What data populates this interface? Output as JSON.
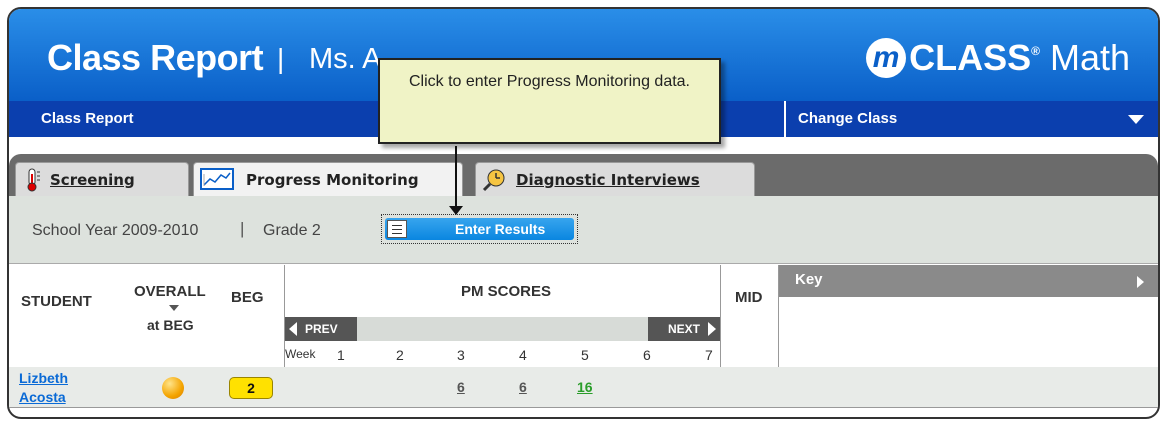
{
  "header": {
    "title": "Class Report",
    "separator": "|",
    "teacher": "Ms. A",
    "logo_m": "m",
    "logo_class": "CLASS",
    "logo_reg": "®",
    "logo_math": "Math"
  },
  "subbar": {
    "left_label": "Class Report",
    "change_class_label": "Change Class"
  },
  "tabs": [
    {
      "label": "Screening",
      "icon": "thermometer-icon"
    },
    {
      "label": "Progress Monitoring",
      "icon": "line-chart-icon"
    },
    {
      "label": "Diagnostic Interviews",
      "icon": "clock-magnifier-icon"
    }
  ],
  "toolbar": {
    "school_year": "School Year 2009-2010",
    "separator": "|",
    "grade": "Grade 2",
    "enter_results_label": "Enter Results"
  },
  "table": {
    "headers": {
      "student": "STUDENT",
      "overall": "OVERALL",
      "overall_sub": "at BEG",
      "beg": "BEG",
      "pm_scores": "PM SCORES",
      "mid": "MID"
    },
    "prev_label": "PREV",
    "next_label": "NEXT",
    "week_label": "Week",
    "weeks": [
      "1",
      "2",
      "3",
      "4",
      "5",
      "6",
      "7"
    ],
    "rows": [
      {
        "student_first": "Lizbeth",
        "student_last": "Acosta",
        "overall_color": "#f4a400",
        "beg": "2",
        "scores": [
          "6",
          "6",
          "16"
        ]
      }
    ]
  },
  "key": {
    "label": "Key"
  },
  "callout": {
    "text": "Click to enter Progress Monitoring data."
  },
  "colors": {
    "header_blue": "#1a78dc",
    "subbar_navy": "#0b3fae",
    "score_green": "#2a9d2a",
    "badge_yellow": "#ffe100"
  }
}
